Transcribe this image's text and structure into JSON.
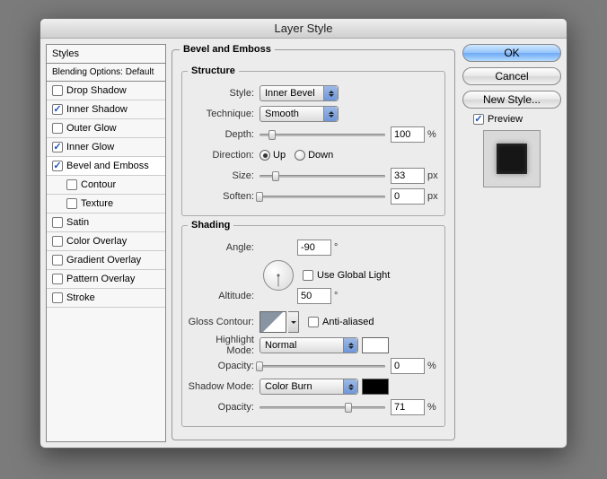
{
  "window": {
    "title": "Layer Style"
  },
  "styles": {
    "header": "Styles",
    "blending": "Blending Options: Default",
    "items": [
      {
        "label": "Drop Shadow",
        "checked": false,
        "indent": false
      },
      {
        "label": "Inner Shadow",
        "checked": true,
        "indent": false
      },
      {
        "label": "Outer Glow",
        "checked": false,
        "indent": false
      },
      {
        "label": "Inner Glow",
        "checked": true,
        "indent": false
      },
      {
        "label": "Bevel and Emboss",
        "checked": true,
        "indent": false,
        "selected": true
      },
      {
        "label": "Contour",
        "checked": false,
        "indent": true
      },
      {
        "label": "Texture",
        "checked": false,
        "indent": true
      },
      {
        "label": "Satin",
        "checked": false,
        "indent": false
      },
      {
        "label": "Color Overlay",
        "checked": false,
        "indent": false
      },
      {
        "label": "Gradient Overlay",
        "checked": false,
        "indent": false
      },
      {
        "label": "Pattern Overlay",
        "checked": false,
        "indent": false
      },
      {
        "label": "Stroke",
        "checked": false,
        "indent": false
      }
    ]
  },
  "main": {
    "title": "Bevel and Emboss",
    "structure": {
      "legend": "Structure",
      "style_label": "Style:",
      "style_value": "Inner Bevel",
      "technique_label": "Technique:",
      "technique_value": "Smooth",
      "depth_label": "Depth:",
      "depth_value": "100",
      "depth_unit": "%",
      "direction_label": "Direction:",
      "up_label": "Up",
      "down_label": "Down",
      "direction": "up",
      "size_label": "Size:",
      "size_value": "33",
      "size_unit": "px",
      "soften_label": "Soften:",
      "soften_value": "0",
      "soften_unit": "px"
    },
    "shading": {
      "legend": "Shading",
      "angle_label": "Angle:",
      "angle_value": "-90",
      "angle_unit": "°",
      "use_global_label": "Use Global Light",
      "use_global": false,
      "altitude_label": "Altitude:",
      "altitude_value": "50",
      "altitude_unit": "°",
      "gloss_label": "Gloss Contour:",
      "aa_label": "Anti-aliased",
      "aa": false,
      "highlight_label": "Highlight Mode:",
      "highlight_value": "Normal",
      "hl_opacity_label": "Opacity:",
      "hl_opacity_value": "0",
      "hl_opacity_unit": "%",
      "shadow_label": "Shadow Mode:",
      "shadow_value": "Color Burn",
      "sh_opacity_label": "Opacity:",
      "sh_opacity_value": "71",
      "sh_opacity_unit": "%"
    }
  },
  "buttons": {
    "ok": "OK",
    "cancel": "Cancel",
    "new_style": "New Style...",
    "preview": "Preview"
  }
}
